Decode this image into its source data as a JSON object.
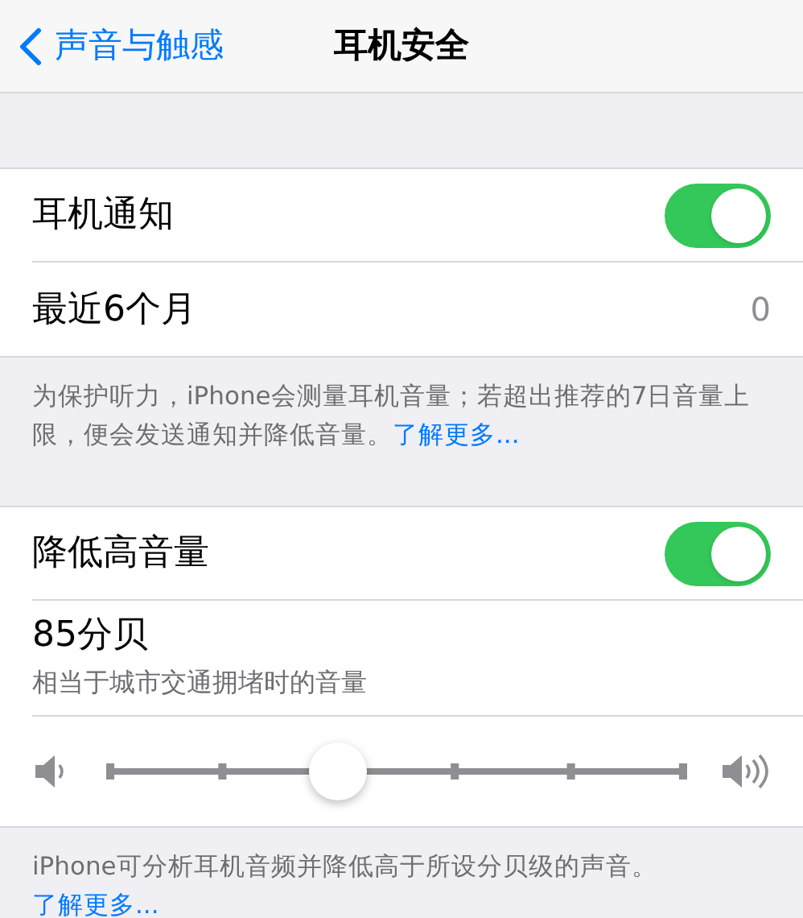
{
  "nav": {
    "back": "声音与触感",
    "title": "耳机安全"
  },
  "sections": [
    {
      "rows": [
        {
          "kind": "toggle",
          "label": "耳机通知",
          "on": true
        },
        {
          "kind": "value",
          "label": "最近6个月",
          "value": "0"
        }
      ],
      "footer": {
        "text": "为保护听力，iPhone会测量耳机音量；若超出推荐的7日音量上限，便会发送通知并降低音量。",
        "link": "了解更多..."
      }
    },
    {
      "rows": [
        {
          "kind": "toggle",
          "label": "降低高音量",
          "on": true
        },
        {
          "kind": "subtitle",
          "label": "85分贝",
          "subtitle": "相当于城市交通拥堵时的音量"
        },
        {
          "kind": "slider",
          "level": 0.4
        }
      ],
      "footer": {
        "text": "iPhone可分析耳机音频并降低高于所设分贝级的声音。",
        "link": "了解更多..."
      }
    }
  ]
}
